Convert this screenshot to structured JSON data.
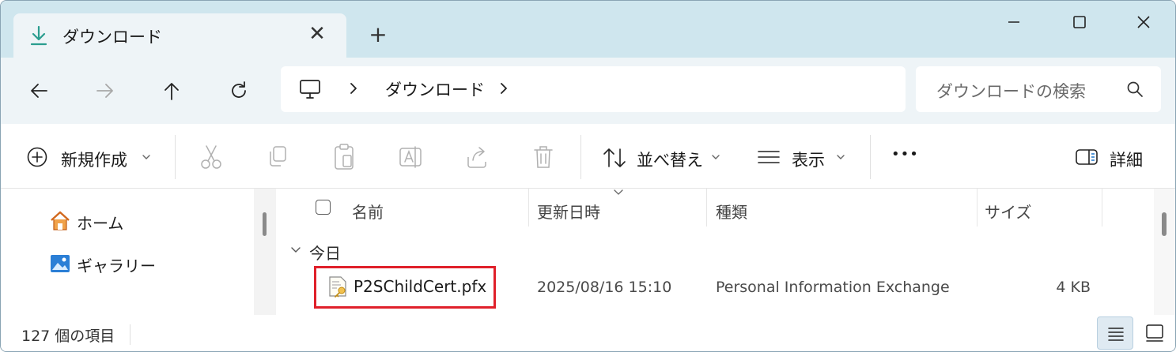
{
  "tab": {
    "title": "ダウンロード",
    "close": "✕"
  },
  "new_tab": "+",
  "address": {
    "crumb": "ダウンロード"
  },
  "search": {
    "placeholder": "ダウンロードの検索"
  },
  "toolbar": {
    "new_label": "新規作成",
    "sort_label": "並べ替え",
    "view_label": "表示",
    "more_label": "•••",
    "details_label": "詳細"
  },
  "sidebar": {
    "items": [
      {
        "label": "ホーム"
      },
      {
        "label": "ギャラリー"
      }
    ]
  },
  "columns": {
    "name": "名前",
    "modified": "更新日時",
    "type": "種類",
    "size": "サイズ"
  },
  "group": {
    "label": "今日"
  },
  "files": [
    {
      "name": "P2SChildCert.pfx",
      "modified": "2025/08/16 15:10",
      "type": "Personal Information Exchange",
      "size": "4 KB"
    }
  ],
  "status": {
    "count": "127 個の項目"
  },
  "colors": {
    "titlebar": "#cfe6ee",
    "highlight": "#e0202a",
    "accent": "#2a9d8f"
  }
}
